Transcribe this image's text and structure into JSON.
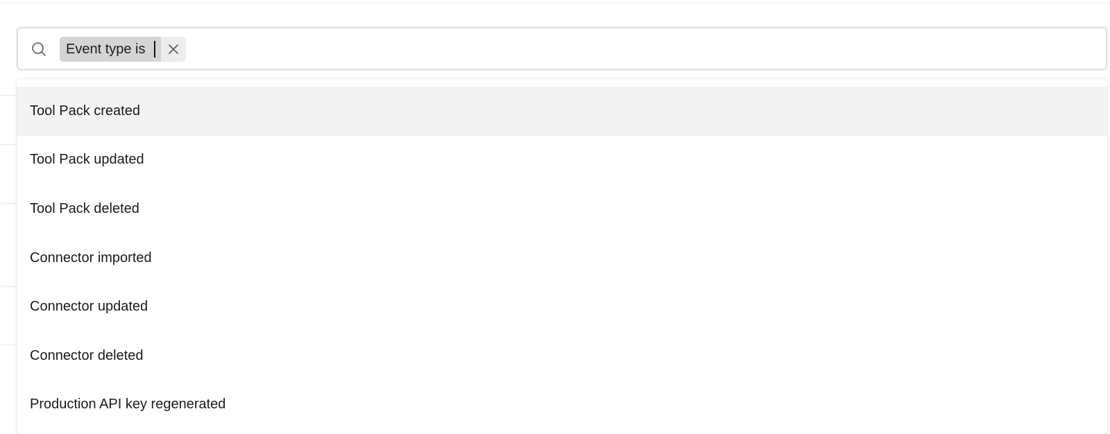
{
  "search": {
    "filter_chip": {
      "label": "Event type is"
    }
  },
  "dropdown": {
    "options": [
      {
        "label": "Tool Pack created",
        "highlighted": true
      },
      {
        "label": "Tool Pack updated",
        "highlighted": false
      },
      {
        "label": "Tool Pack deleted",
        "highlighted": false
      },
      {
        "label": "Connector imported",
        "highlighted": false
      },
      {
        "label": "Connector updated",
        "highlighted": false
      },
      {
        "label": "Connector deleted",
        "highlighted": false
      },
      {
        "label": "Production API key regenerated",
        "highlighted": false
      }
    ]
  },
  "icons": {
    "search": "search-icon",
    "remove_filter": "close-icon"
  },
  "colors": {
    "chip_background": "#d4d4d4",
    "chip_remove_background": "#ececec",
    "highlight_background": "#f3f3f3",
    "border": "#e2e2e2"
  }
}
